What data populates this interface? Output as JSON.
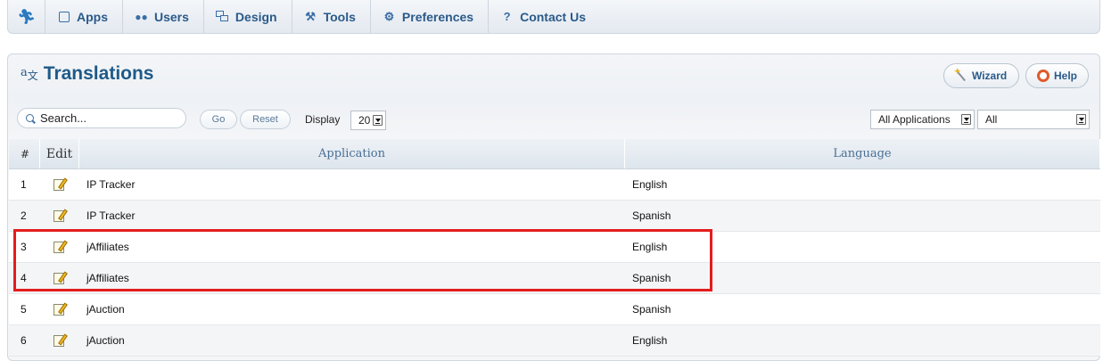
{
  "nav": {
    "items": [
      {
        "label": "Apps",
        "icon": "apps-icon"
      },
      {
        "label": "Users",
        "icon": "users-icon"
      },
      {
        "label": "Design",
        "icon": "design-icon"
      },
      {
        "label": "Tools",
        "icon": "wrench-icon"
      },
      {
        "label": "Preferences",
        "icon": "gear-icon"
      },
      {
        "label": "Contact Us",
        "icon": "question-icon"
      }
    ]
  },
  "header": {
    "title": "Translations",
    "wizard_label": "Wizard",
    "help_label": "Help"
  },
  "toolbar": {
    "search_placeholder": "Search...",
    "go_label": "Go",
    "reset_label": "Reset",
    "display_label": "Display",
    "display_value": "20",
    "app_filter_value": "All Applications",
    "lang_filter_value": "All"
  },
  "table": {
    "columns": {
      "num": "#",
      "edit": "Edit",
      "application": "Application",
      "language": "Language"
    },
    "rows": [
      {
        "num": "1",
        "application": "IP Tracker",
        "language": "English"
      },
      {
        "num": "2",
        "application": "IP Tracker",
        "language": "Spanish"
      },
      {
        "num": "3",
        "application": "jAffiliates",
        "language": "English"
      },
      {
        "num": "4",
        "application": "jAffiliates",
        "language": "Spanish"
      },
      {
        "num": "5",
        "application": "jAuction",
        "language": "Spanish"
      },
      {
        "num": "6",
        "application": "jAuction",
        "language": "English"
      }
    ]
  },
  "highlight": {
    "color": "#e41d1d"
  }
}
